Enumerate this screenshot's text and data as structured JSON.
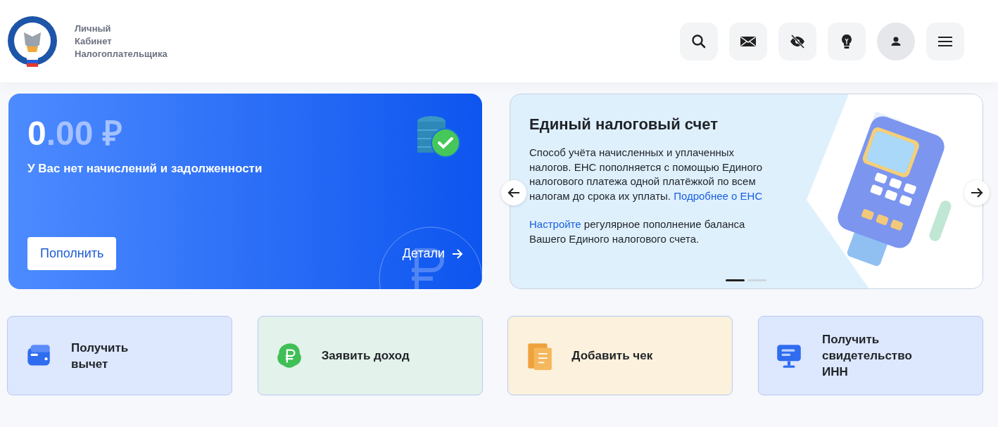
{
  "header": {
    "title_lines": [
      "Личный",
      "Кабинет",
      "Налогоплательщика"
    ],
    "icons": [
      {
        "kind": "search"
      },
      {
        "kind": "mail"
      },
      {
        "kind": "eye-off"
      },
      {
        "kind": "bulb"
      },
      {
        "kind": "profile"
      },
      {
        "kind": "menu"
      }
    ]
  },
  "balance": {
    "amount_integer": "0",
    "amount_rest": ".00 ₽",
    "message": "У Вас нет начислений и задолженности",
    "button": "Пополнить",
    "details_link": "Детали"
  },
  "promo": {
    "title": "Единый налоговый счет",
    "paragraphs": [
      [
        {
          "kind": "text",
          "text": "Способ учёта начисленных и уплаченных налогов. ЕНС пополняется с помощью Единого налогового платежа одной платёжкой по всем налогам до срока их уплаты. "
        },
        {
          "kind": "link",
          "text": "Подробнее о ЕНС"
        }
      ],
      [
        {
          "kind": "link",
          "text": "Настройте"
        },
        {
          "kind": "text",
          "text": " регулярное пополнение баланса Вашего Единого налогового счета."
        }
      ]
    ],
    "dots": [
      {
        "selected": true
      },
      {
        "selected": false
      }
    ]
  },
  "actions": [
    {
      "label": "Получить вычет",
      "color": "#dde7fd",
      "kind": "wallet"
    },
    {
      "label": "Заявить доход",
      "color": "#e3f2ea",
      "kind": "money"
    },
    {
      "label": "Добавить чек",
      "color": "#fbf1dc",
      "kind": "receipt"
    },
    {
      "label": "Получить свидетельство ИНН",
      "color": "#dde7fd",
      "kind": "monitor"
    }
  ]
}
